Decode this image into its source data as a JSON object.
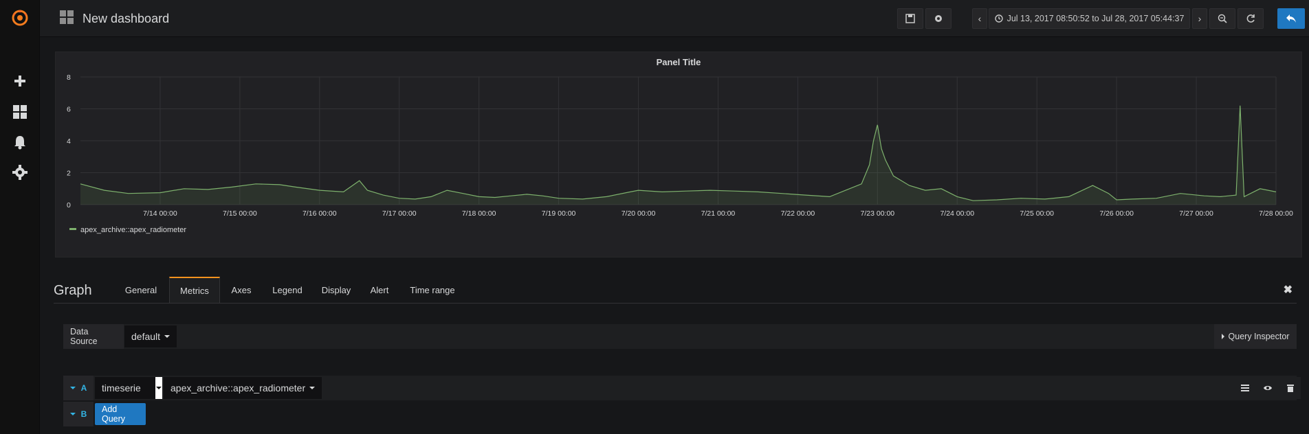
{
  "sidebar": {
    "items": [
      {
        "icon": "grafana-logo-icon"
      },
      {
        "icon": "plus-icon"
      },
      {
        "icon": "dashboards-icon"
      },
      {
        "icon": "bell-icon"
      },
      {
        "icon": "gear-icon"
      }
    ]
  },
  "header": {
    "title": "New dashboard",
    "time_range": "Jul 13, 2017 08:50:52 to Jul 28, 2017 05:44:37"
  },
  "panel": {
    "title": "Panel Title"
  },
  "chart_data": {
    "type": "line",
    "title": "Panel Title",
    "x_ticks": [
      "7/14 00:00",
      "7/15 00:00",
      "7/16 00:00",
      "7/17 00:00",
      "7/18 00:00",
      "7/19 00:00",
      "7/20 00:00",
      "7/21 00:00",
      "7/22 00:00",
      "7/23 00:00",
      "7/24 00:00",
      "7/25 00:00",
      "7/26 00:00",
      "7/27 00:00",
      "7/28 00:00"
    ],
    "y_ticks": [
      "0",
      "2",
      "4",
      "6",
      "8"
    ],
    "ylim": [
      0,
      8
    ],
    "xlim_days": [
      13.0,
      28.0
    ],
    "grid": true,
    "legend_position": "bottom-left",
    "series": [
      {
        "name": "apex_archive::apex_radiometer",
        "color": "#7eb26d",
        "x": [
          13.0,
          13.3,
          13.6,
          14.0,
          14.3,
          14.6,
          14.9,
          15.2,
          15.5,
          15.7,
          16.0,
          16.3,
          16.5,
          16.6,
          16.8,
          17.0,
          17.2,
          17.4,
          17.6,
          17.8,
          18.0,
          18.2,
          18.4,
          18.6,
          18.8,
          19.0,
          19.3,
          19.6,
          19.9,
          20.0,
          20.3,
          20.6,
          20.9,
          21.2,
          21.5,
          21.8,
          22.1,
          22.4,
          22.6,
          22.8,
          22.9,
          22.95,
          23.0,
          23.05,
          23.1,
          23.2,
          23.4,
          23.6,
          23.8,
          24.0,
          24.2,
          24.5,
          24.8,
          25.1,
          25.4,
          25.7,
          25.9,
          26.0,
          26.2,
          26.5,
          26.8,
          27.1,
          27.3,
          27.5,
          27.55,
          27.6,
          27.8,
          28.0
        ],
        "y": [
          1.3,
          0.9,
          0.7,
          0.75,
          1.0,
          0.95,
          1.1,
          1.3,
          1.25,
          1.1,
          0.9,
          0.8,
          1.5,
          0.9,
          0.6,
          0.4,
          0.35,
          0.5,
          0.9,
          0.7,
          0.5,
          0.45,
          0.55,
          0.65,
          0.55,
          0.4,
          0.35,
          0.5,
          0.8,
          0.9,
          0.8,
          0.85,
          0.9,
          0.85,
          0.8,
          0.7,
          0.6,
          0.5,
          0.9,
          1.3,
          2.5,
          4.0,
          5.0,
          3.5,
          2.8,
          1.8,
          1.2,
          0.9,
          1.0,
          0.5,
          0.25,
          0.3,
          0.4,
          0.35,
          0.5,
          1.2,
          0.7,
          0.3,
          0.35,
          0.4,
          0.7,
          0.55,
          0.5,
          0.6,
          6.2,
          0.5,
          1.0,
          0.8
        ]
      }
    ]
  },
  "legend": {
    "series_label": "apex_archive::apex_radiometer"
  },
  "editor": {
    "title": "Graph",
    "tabs": [
      "General",
      "Metrics",
      "Axes",
      "Legend",
      "Display",
      "Alert",
      "Time range"
    ],
    "active_tab": "Metrics",
    "close_label": "✖",
    "datasource_label": "Data Source",
    "datasource_value": "default",
    "query_inspector_label": "Query Inspector",
    "query_a": {
      "letter": "A",
      "type": "timeserie",
      "metric": "apex_archive::apex_radiometer"
    },
    "query_b": {
      "letter": "B",
      "add_label": "Add Query"
    }
  }
}
